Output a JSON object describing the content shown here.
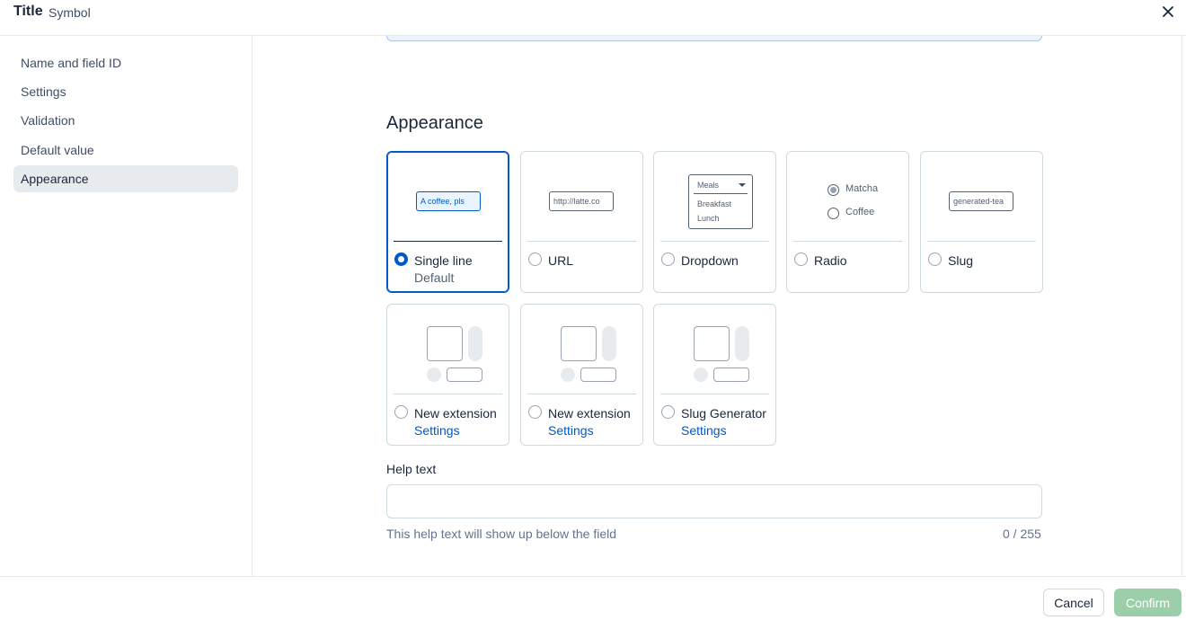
{
  "header": {
    "title": "Title",
    "subtitle": "Symbol",
    "close_icon": "close-icon"
  },
  "sidebar": {
    "items": [
      {
        "label": "Name and field ID",
        "active": false
      },
      {
        "label": "Settings",
        "active": false
      },
      {
        "label": "Validation",
        "active": false
      },
      {
        "label": "Default value",
        "active": false
      },
      {
        "label": "Appearance",
        "active": true
      }
    ]
  },
  "appearance": {
    "title": "Appearance",
    "options": [
      {
        "label": "Single line",
        "sub": "Default",
        "selected": true,
        "preview_text": "A coffee, pls"
      },
      {
        "label": "URL",
        "selected": false,
        "preview_text": "http://latte.co"
      },
      {
        "label": "Dropdown",
        "selected": false,
        "preview": {
          "selected": "Meals",
          "items": [
            "Breakfast",
            "Lunch"
          ]
        }
      },
      {
        "label": "Radio",
        "selected": false,
        "preview": {
          "items": [
            "Matcha",
            "Coffee"
          ]
        }
      },
      {
        "label": "Slug",
        "selected": false,
        "preview_text": "generated-tea"
      },
      {
        "label": "New extension",
        "sub": "Settings",
        "selected": false
      },
      {
        "label": "New extension",
        "sub": "Settings",
        "selected": false
      },
      {
        "label": "Slug Generator",
        "sub": "Settings",
        "selected": false
      }
    ]
  },
  "help_text": {
    "label": "Help text",
    "value": "",
    "hint": "This help text will show up below the field",
    "count": "0 / 255"
  },
  "footer": {
    "cancel_label": "Cancel",
    "confirm_label": "Confirm"
  },
  "colors": {
    "primary": "#0059c8",
    "confirm_disabled": "#9ccfa9",
    "border": "#cfd9e0"
  }
}
